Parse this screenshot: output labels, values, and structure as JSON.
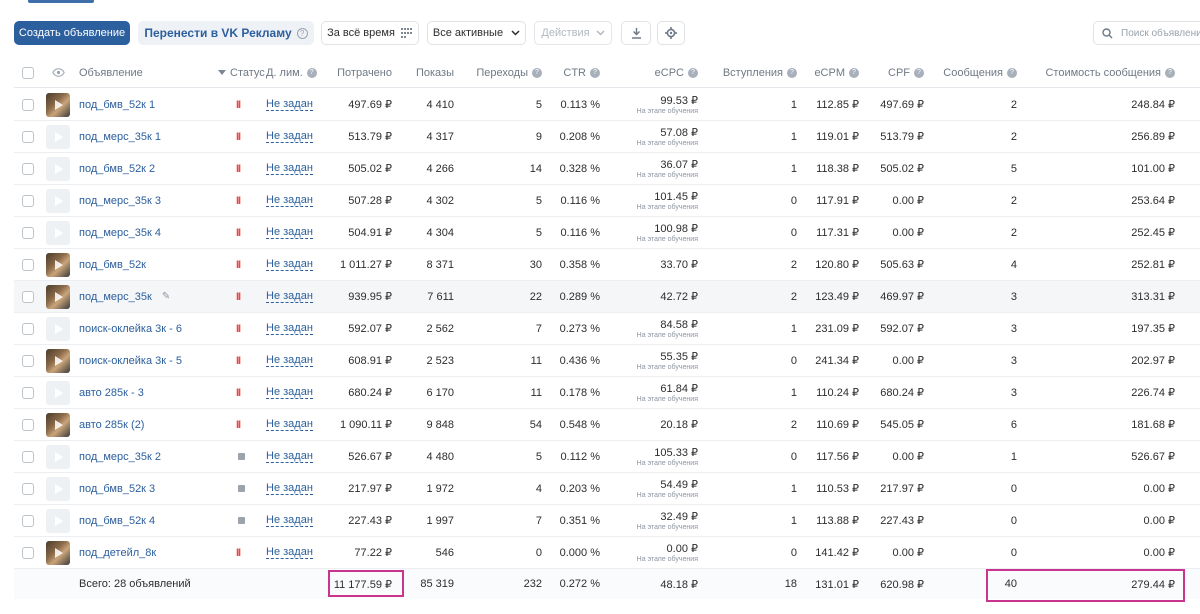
{
  "toolbar": {
    "create_label": "Создать объявление",
    "transfer_label": "Перенести в VK Рекламу",
    "period_label": "За всё время",
    "filter_label": "Все активные",
    "actions_label": "Действия",
    "search_placeholder": "Поиск объявлений"
  },
  "columns": {
    "ad": "Объявление",
    "status": "Статус",
    "limit": "Д. лим.",
    "spent": "Потрачено",
    "impressions": "Показы",
    "clicks": "Переходы",
    "ctr": "CTR",
    "ecpc": "eCPC",
    "joins": "Вступления",
    "ecpm": "eCPM",
    "cpf": "CPF",
    "messages": "Сообщения",
    "message_cost": "Стоимость сообщения"
  },
  "rows": [
    {
      "name": "под_бмв_52к 1",
      "thumb": "photo",
      "status": "paused",
      "limit": "Не задан",
      "spent": "497.69 ₽",
      "impressions": "4 410",
      "clicks": "5",
      "ctr": "0.113 %",
      "ecpc": "99.53 ₽",
      "ecpc_note": "На этапе обучения",
      "joins": "1",
      "ecpm": "112.85 ₽",
      "cpf": "497.69 ₽",
      "messages": "2",
      "message_cost": "248.84 ₽"
    },
    {
      "name": "под_мерс_35к 1",
      "thumb": "empty",
      "status": "paused",
      "limit": "Не задан",
      "spent": "513.79 ₽",
      "impressions": "4 317",
      "clicks": "9",
      "ctr": "0.208 %",
      "ecpc": "57.08 ₽",
      "ecpc_note": "На этапе обучения",
      "joins": "1",
      "ecpm": "119.01 ₽",
      "cpf": "513.79 ₽",
      "messages": "2",
      "message_cost": "256.89 ₽"
    },
    {
      "name": "под_бмв_52к 2",
      "thumb": "empty",
      "status": "paused",
      "limit": "Не задан",
      "spent": "505.02 ₽",
      "impressions": "4 266",
      "clicks": "14",
      "ctr": "0.328 %",
      "ecpc": "36.07 ₽",
      "ecpc_note": "На этапе обучения",
      "joins": "1",
      "ecpm": "118.38 ₽",
      "cpf": "505.02 ₽",
      "messages": "5",
      "message_cost": "101.00 ₽"
    },
    {
      "name": "под_мерс_35к 3",
      "thumb": "empty",
      "status": "paused",
      "limit": "Не задан",
      "spent": "507.28 ₽",
      "impressions": "4 302",
      "clicks": "5",
      "ctr": "0.116 %",
      "ecpc": "101.45 ₽",
      "ecpc_note": "На этапе обучения",
      "joins": "0",
      "ecpm": "117.91 ₽",
      "cpf": "0.00 ₽",
      "messages": "2",
      "message_cost": "253.64 ₽"
    },
    {
      "name": "под_мерс_35к 4",
      "thumb": "empty",
      "status": "paused",
      "limit": "Не задан",
      "spent": "504.91 ₽",
      "impressions": "4 304",
      "clicks": "5",
      "ctr": "0.116 %",
      "ecpc": "100.98 ₽",
      "ecpc_note": "На этапе обучения",
      "joins": "0",
      "ecpm": "117.31 ₽",
      "cpf": "0.00 ₽",
      "messages": "2",
      "message_cost": "252.45 ₽"
    },
    {
      "name": "под_бмв_52к",
      "thumb": "photo",
      "status": "paused",
      "limit": "Не задан",
      "spent": "1 011.27 ₽",
      "impressions": "8 371",
      "clicks": "30",
      "ctr": "0.358 %",
      "ecpc": "33.70 ₽",
      "ecpc_note": "",
      "joins": "2",
      "ecpm": "120.80 ₽",
      "cpf": "505.63 ₽",
      "messages": "4",
      "message_cost": "252.81 ₽"
    },
    {
      "name": "под_мерс_35к",
      "thumb": "photo",
      "status": "paused",
      "limit": "Не задан",
      "spent": "939.95 ₽",
      "impressions": "7 611",
      "clicks": "22",
      "ctr": "0.289 %",
      "ecpc": "42.72 ₽",
      "ecpc_note": "",
      "joins": "2",
      "ecpm": "123.49 ₽",
      "cpf": "469.97 ₽",
      "messages": "3",
      "message_cost": "313.31 ₽",
      "edit": true
    },
    {
      "name": "поиск-оклейка 3к - 6",
      "thumb": "empty",
      "status": "paused",
      "limit": "Не задан",
      "spent": "592.07 ₽",
      "impressions": "2 562",
      "clicks": "7",
      "ctr": "0.273 %",
      "ecpc": "84.58 ₽",
      "ecpc_note": "На этапе обучения",
      "joins": "1",
      "ecpm": "231.09 ₽",
      "cpf": "592.07 ₽",
      "messages": "3",
      "message_cost": "197.35 ₽"
    },
    {
      "name": "поиск-оклейка 3к - 5",
      "thumb": "photo",
      "status": "paused",
      "limit": "Не задан",
      "spent": "608.91 ₽",
      "impressions": "2 523",
      "clicks": "11",
      "ctr": "0.436 %",
      "ecpc": "55.35 ₽",
      "ecpc_note": "На этапе обучения",
      "joins": "0",
      "ecpm": "241.34 ₽",
      "cpf": "0.00 ₽",
      "messages": "3",
      "message_cost": "202.97 ₽"
    },
    {
      "name": "авто 285к - 3",
      "thumb": "empty",
      "status": "paused",
      "limit": "Не задан",
      "spent": "680.24 ₽",
      "impressions": "6 170",
      "clicks": "11",
      "ctr": "0.178 %",
      "ecpc": "61.84 ₽",
      "ecpc_note": "На этапе обучения",
      "joins": "1",
      "ecpm": "110.24 ₽",
      "cpf": "680.24 ₽",
      "messages": "3",
      "message_cost": "226.74 ₽"
    },
    {
      "name": "авто 285к (2)",
      "thumb": "photo",
      "status": "paused",
      "limit": "Не задан",
      "spent": "1 090.11 ₽",
      "impressions": "9 848",
      "clicks": "54",
      "ctr": "0.548 %",
      "ecpc": "20.18 ₽",
      "ecpc_note": "",
      "joins": "2",
      "ecpm": "110.69 ₽",
      "cpf": "545.05 ₽",
      "messages": "6",
      "message_cost": "181.68 ₽"
    },
    {
      "name": "под_мерс_35к 2",
      "thumb": "empty",
      "status": "stopped",
      "limit": "Не задан",
      "spent": "526.67 ₽",
      "impressions": "4 480",
      "clicks": "5",
      "ctr": "0.112 %",
      "ecpc": "105.33 ₽",
      "ecpc_note": "На этапе обучения",
      "joins": "0",
      "ecpm": "117.56 ₽",
      "cpf": "0.00 ₽",
      "messages": "1",
      "message_cost": "526.67 ₽"
    },
    {
      "name": "под_бмв_52к 3",
      "thumb": "empty",
      "status": "stopped",
      "limit": "Не задан",
      "spent": "217.97 ₽",
      "impressions": "1 972",
      "clicks": "4",
      "ctr": "0.203 %",
      "ecpc": "54.49 ₽",
      "ecpc_note": "На этапе обучения",
      "joins": "1",
      "ecpm": "110.53 ₽",
      "cpf": "217.97 ₽",
      "messages": "0",
      "message_cost": "0.00 ₽"
    },
    {
      "name": "под_бмв_52к 4",
      "thumb": "empty",
      "status": "stopped",
      "limit": "Не задан",
      "spent": "227.43 ₽",
      "impressions": "1 997",
      "clicks": "7",
      "ctr": "0.351 %",
      "ecpc": "32.49 ₽",
      "ecpc_note": "На этапе обучения",
      "joins": "1",
      "ecpm": "113.88 ₽",
      "cpf": "227.43 ₽",
      "messages": "0",
      "message_cost": "0.00 ₽"
    },
    {
      "name": "под_детейл_8к",
      "thumb": "photo",
      "status": "paused",
      "limit": "Не задан",
      "spent": "77.22 ₽",
      "impressions": "546",
      "clicks": "0",
      "ctr": "0.000 %",
      "ecpc": "0.00 ₽",
      "ecpc_note": "На этапе обучения",
      "joins": "0",
      "ecpm": "141.42 ₽",
      "cpf": "0.00 ₽",
      "messages": "0",
      "message_cost": "0.00 ₽"
    }
  ],
  "total": {
    "label": "Всего: 28 объявлений",
    "spent": "11 177.59 ₽",
    "impressions": "85 319",
    "clicks": "232",
    "ctr": "0.272 %",
    "ecpc": "48.18 ₽",
    "joins": "18",
    "ecpm": "131.01 ₽",
    "cpf": "620.98 ₽",
    "messages": "40",
    "message_cost": "279.44 ₽"
  },
  "colors": {
    "accent": "#2c5f9e",
    "highlight_frame": "#c8348e",
    "paused": "#e64646"
  }
}
